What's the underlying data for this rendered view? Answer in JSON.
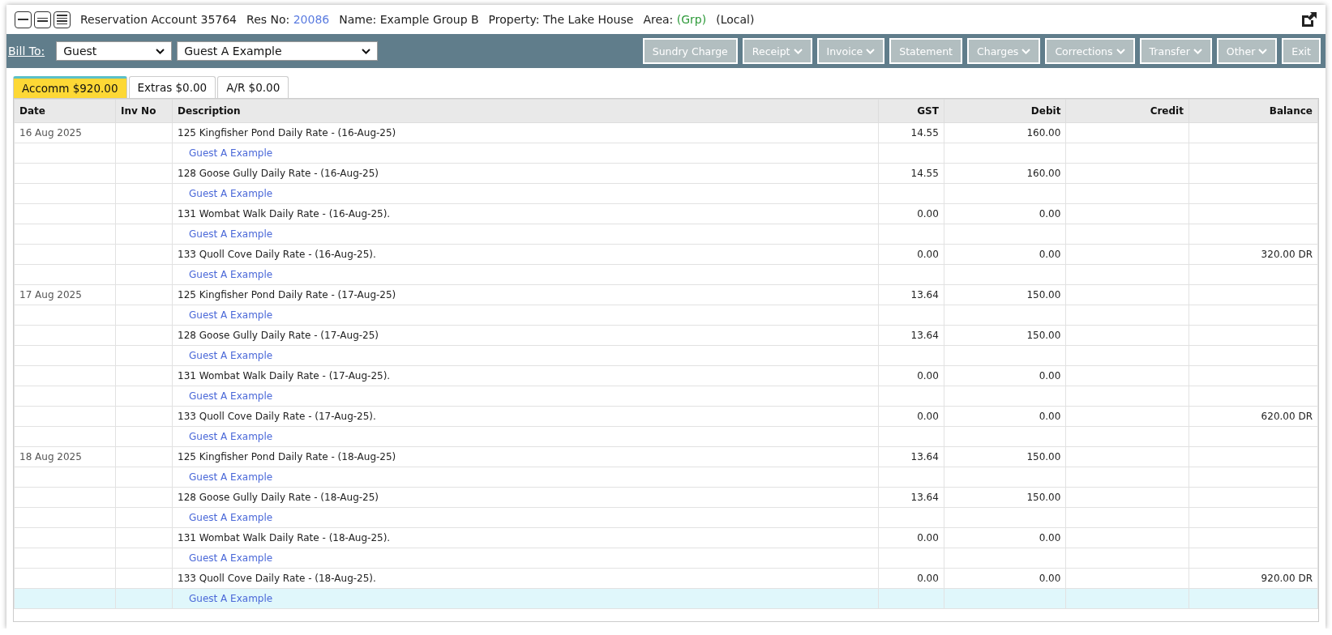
{
  "header": {
    "title": "Reservation Account 35764",
    "res_no_label": "Res No:",
    "res_no": "20086",
    "name": "Name: Example Group B",
    "property": "Property: The Lake House",
    "area_label": "Area:",
    "area": "(Grp)",
    "scope": "(Local)"
  },
  "toolbar": {
    "bill_to_label": "Bill To:",
    "bill_to_type": "Guest",
    "bill_to_guest": "Guest A Example",
    "buttons": [
      {
        "label": "Sundry Charge",
        "dropdown": false
      },
      {
        "label": "Receipt",
        "dropdown": true
      },
      {
        "label": "Invoice",
        "dropdown": true
      },
      {
        "label": "Statement",
        "dropdown": false
      },
      {
        "label": "Charges",
        "dropdown": true
      },
      {
        "label": "Corrections",
        "dropdown": true
      },
      {
        "label": "Transfer",
        "dropdown": true
      },
      {
        "label": "Other",
        "dropdown": true
      },
      {
        "label": "Exit",
        "dropdown": false
      }
    ]
  },
  "tabs": [
    {
      "label": "Accomm $920.00",
      "selected": true
    },
    {
      "label": "Extras $0.00",
      "selected": false
    },
    {
      "label": "A/R $0.00",
      "selected": false
    }
  ],
  "table": {
    "columns": [
      "Date",
      "Inv No",
      "Description",
      "GST",
      "Debit",
      "Credit",
      "Balance"
    ],
    "rows": [
      {
        "date": "16 Aug 2025",
        "description": "125 Kingfisher Pond Daily Rate  - (16-Aug-25)",
        "gst": "14.55",
        "debit": "160.00",
        "guest": "Guest A Example",
        "selected": false
      },
      {
        "description": "128 Goose Gully Daily Rate  - (16-Aug-25)",
        "gst": "14.55",
        "debit": "160.00",
        "guest": "Guest A Example",
        "selected": false
      },
      {
        "description": "131 Wombat Walk Daily Rate  - (16-Aug-25).",
        "gst": "0.00",
        "debit": "0.00",
        "guest": "Guest A Example",
        "selected": false
      },
      {
        "description": "133 Quoll Cove Daily Rate  - (16-Aug-25).",
        "gst": "0.00",
        "debit": "0.00",
        "balance": "320.00 DR",
        "guest": "Guest A Example",
        "selected": false
      },
      {
        "date": "17 Aug 2025",
        "description": "125 Kingfisher Pond Daily Rate  - (17-Aug-25)",
        "gst": "13.64",
        "debit": "150.00",
        "guest": "Guest A Example",
        "selected": false
      },
      {
        "description": "128 Goose Gully Daily Rate  - (17-Aug-25)",
        "gst": "13.64",
        "debit": "150.00",
        "guest": "Guest A Example",
        "selected": false
      },
      {
        "description": "131 Wombat Walk Daily Rate  - (17-Aug-25).",
        "gst": "0.00",
        "debit": "0.00",
        "guest": "Guest A Example",
        "selected": false
      },
      {
        "description": "133 Quoll Cove Daily Rate  - (17-Aug-25).",
        "gst": "0.00",
        "debit": "0.00",
        "balance": "620.00 DR",
        "guest": "Guest A Example",
        "selected": false
      },
      {
        "date": "18 Aug 2025",
        "description": "125 Kingfisher Pond Daily Rate  - (18-Aug-25)",
        "gst": "13.64",
        "debit": "150.00",
        "guest": "Guest A Example",
        "selected": false
      },
      {
        "description": "128 Goose Gully Daily Rate  - (18-Aug-25)",
        "gst": "13.64",
        "debit": "150.00",
        "guest": "Guest A Example",
        "selected": false
      },
      {
        "description": "131 Wombat Walk Daily Rate  - (18-Aug-25).",
        "gst": "0.00",
        "debit": "0.00",
        "guest": "Guest A Example",
        "selected": false
      },
      {
        "description": "133 Quoll Cove Daily Rate  - (18-Aug-25).",
        "gst": "0.00",
        "debit": "0.00",
        "balance": "920.00 DR",
        "guest": "Guest A Example",
        "selected": true
      }
    ]
  }
}
